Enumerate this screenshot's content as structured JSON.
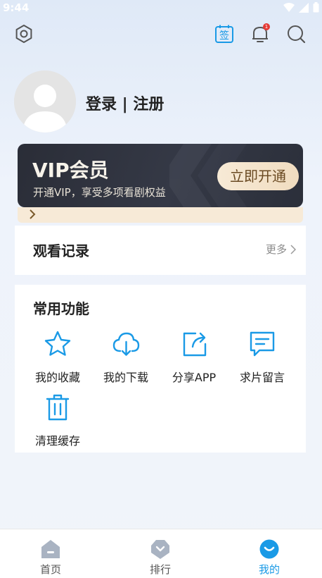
{
  "status_bar": {
    "time": "9:44"
  },
  "header": {
    "sign_in_label": "签",
    "notification_count": "1"
  },
  "profile": {
    "login_register": "登录 | 注册"
  },
  "vip": {
    "title": "VIP会员",
    "subtitle": "开通VIP，享受多项看剧权益",
    "button": "立即开通"
  },
  "history": {
    "title": "观看记录",
    "more": "更多"
  },
  "functions": {
    "title": "常用功能",
    "items": [
      {
        "label": "我的收藏",
        "icon": "star-icon"
      },
      {
        "label": "我的下载",
        "icon": "cloud-download-icon"
      },
      {
        "label": "分享APP",
        "icon": "share-icon"
      },
      {
        "label": "求片留言",
        "icon": "message-icon"
      },
      {
        "label": "清理缓存",
        "icon": "trash-icon"
      }
    ]
  },
  "tabs": [
    {
      "label": "首页",
      "icon": "home-icon",
      "active": false
    },
    {
      "label": "排行",
      "icon": "ranking-icon",
      "active": false
    },
    {
      "label": "我的",
      "icon": "profile-icon",
      "active": true
    }
  ],
  "colors": {
    "accent": "#1a9ae6",
    "vip_gold": "#f0dcc0",
    "vip_dark": "#2a2d37"
  }
}
